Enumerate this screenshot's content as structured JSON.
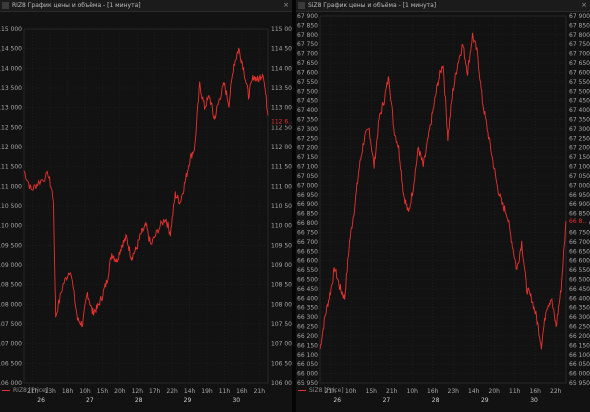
{
  "colors": {
    "background": "#121212",
    "line": "#e8322f",
    "grid": "#2a2a2a",
    "last_price": "#e8322f"
  },
  "icons": [
    "chart-icon",
    "close-icon"
  ],
  "chart_data": [
    {
      "type": "line",
      "title": "RIZ8 График цены и объёма - [1 минута]",
      "legend": "RIZ8 [Price]",
      "ylim": [
        106000,
        115000
      ],
      "y_ticks": [
        "115 000",
        "114 500",
        "114 000",
        "113 500",
        "113 000",
        "112 500",
        "112 000",
        "111 500",
        "111 000",
        "110 500",
        "110 000",
        "109 500",
        "109 000",
        "108 500",
        "108 000",
        "107 500",
        "107 000",
        "106 500",
        "106 000"
      ],
      "x_ticks_time": [
        "21h",
        "13h",
        "18h",
        "10h",
        "15h",
        "20h",
        "12h",
        "17h",
        "22h",
        "14h",
        "19h",
        "11h",
        "16h",
        "21h"
      ],
      "x_ticks_date": [
        "26",
        "27",
        "28",
        "29",
        "30"
      ],
      "last_price_label": "112 6..",
      "last_price": 112650,
      "series": [
        {
          "x": [
            0.0,
            0.03,
            0.06,
            0.1,
            0.12,
            0.13,
            0.16,
            0.19,
            0.22,
            0.24,
            0.26,
            0.28,
            0.3,
            0.32,
            0.34,
            0.36,
            0.38,
            0.4,
            0.42,
            0.44,
            0.46,
            0.48,
            0.5,
            0.52,
            0.55,
            0.58,
            0.6,
            0.62,
            0.64,
            0.66,
            0.68,
            0.7,
            0.72,
            0.74,
            0.76,
            0.78,
            0.8,
            0.82,
            0.84,
            0.86,
            0.88,
            0.9,
            0.92,
            0.94,
            0.96,
            0.98,
            1.0
          ],
          "values": [
            111400,
            110900,
            111100,
            111300,
            110700,
            107700,
            108500,
            108900,
            107600,
            107500,
            108300,
            107800,
            107900,
            108200,
            108600,
            109300,
            109100,
            109500,
            109700,
            109200,
            109400,
            109800,
            110000,
            109500,
            109900,
            110200,
            109800,
            110800,
            110600,
            111100,
            111700,
            112000,
            113600,
            113000,
            113300,
            112700,
            113200,
            113600,
            113100,
            114100,
            114500,
            114000,
            113300,
            113800,
            113700,
            113900,
            112800
          ]
        }
      ]
    },
    {
      "type": "line",
      "title": "SiZ8 График цены и объёма - [1 минута]",
      "legend": "SiZ8 [Price]",
      "ylim": [
        65950,
        67900
      ],
      "y_ticks": [
        "67 900",
        "67 850",
        "67 800",
        "67 750",
        "67 700",
        "67 650",
        "67 600",
        "67 550",
        "67 500",
        "67 450",
        "67 400",
        "67 350",
        "67 300",
        "67 250",
        "67 200",
        "67 150",
        "67 100",
        "67 050",
        "67 000",
        "66 950",
        "66 900",
        "66 850",
        "66 800",
        "66 750",
        "66 700",
        "66 650",
        "66 600",
        "66 550",
        "66 500",
        "66 450",
        "66 400",
        "66 350",
        "66 300",
        "66 250",
        "66 200",
        "66 150",
        "66 100",
        "66 050",
        "66 000",
        "65 950"
      ],
      "x_ticks_time": [
        "21h",
        "10h",
        "15h",
        "21h",
        "10h",
        "16h",
        "23h",
        "14h",
        "20h",
        "11h",
        "16h",
        "22h"
      ],
      "x_ticks_date": [
        "26",
        "27",
        "28",
        "29",
        "30"
      ],
      "last_price_label": "66 8..",
      "last_price": 66810,
      "series": [
        {
          "x": [
            0.0,
            0.02,
            0.04,
            0.06,
            0.08,
            0.1,
            0.12,
            0.14,
            0.16,
            0.18,
            0.2,
            0.22,
            0.24,
            0.26,
            0.28,
            0.3,
            0.32,
            0.34,
            0.36,
            0.38,
            0.4,
            0.42,
            0.44,
            0.46,
            0.48,
            0.5,
            0.52,
            0.54,
            0.56,
            0.58,
            0.6,
            0.62,
            0.64,
            0.66,
            0.68,
            0.7,
            0.72,
            0.74,
            0.76,
            0.78,
            0.8,
            0.82,
            0.84,
            0.86,
            0.88,
            0.9,
            0.92,
            0.94,
            0.96,
            0.98,
            1.0
          ],
          "values": [
            66130,
            66300,
            66420,
            66560,
            66460,
            66400,
            66700,
            66880,
            67100,
            67250,
            67300,
            67100,
            67350,
            67450,
            67580,
            67300,
            67200,
            66950,
            66850,
            67000,
            67200,
            67100,
            67250,
            67400,
            67550,
            67650,
            67250,
            67500,
            67650,
            67750,
            67600,
            67800,
            67700,
            67450,
            67300,
            67150,
            67000,
            66900,
            66850,
            66700,
            66550,
            66700,
            66450,
            66400,
            66300,
            66150,
            66350,
            66400,
            66250,
            66450,
            66810
          ]
        }
      ]
    }
  ]
}
